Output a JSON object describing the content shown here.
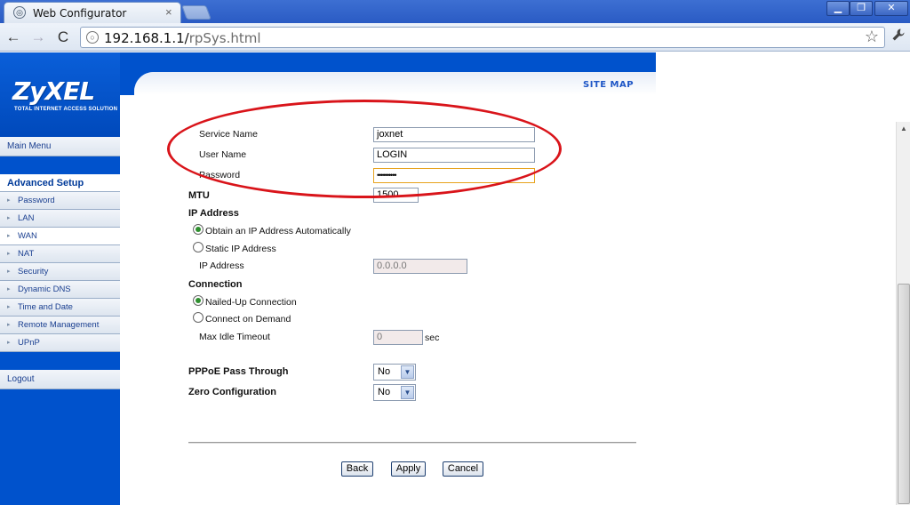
{
  "browser": {
    "tab_title": "Web Configurator",
    "tab_close": "×",
    "url_host": "192.168.1.1/",
    "url_path": "rpSys.html",
    "back_icon": "←",
    "forward_icon": "→",
    "reload_icon": "C",
    "star_icon": "☆",
    "wrench_icon": "wrench-icon",
    "window_buttons": {
      "minimize": "▁",
      "maximize": "❐",
      "close": "✕"
    }
  },
  "logo": {
    "name": "ZyXEL",
    "tagline": "TOTAL INTERNET ACCESS SOLUTION"
  },
  "sidebar": {
    "main_menu": "Main Menu",
    "section": "Advanced Setup",
    "items": [
      {
        "label": "Password"
      },
      {
        "label": "LAN"
      },
      {
        "label": "WAN",
        "active": true
      },
      {
        "label": "NAT"
      },
      {
        "label": "Security"
      },
      {
        "label": "Dynamic DNS"
      },
      {
        "label": "Time and Date"
      },
      {
        "label": "Remote Management"
      },
      {
        "label": "UPnP"
      }
    ],
    "logout": "Logout"
  },
  "header": {
    "site_map": "SITE MAP"
  },
  "form": {
    "service_name": {
      "label": "Service Name",
      "value": "joxnet"
    },
    "user_name": {
      "label": "User Name",
      "value": "LOGIN"
    },
    "password": {
      "label": "Password",
      "value": "••••••••••"
    },
    "mtu": {
      "label": "MTU",
      "value": "1500"
    },
    "ip_address_section": "IP Address",
    "obtain_auto": "Obtain an IP Address Automatically",
    "static_ip": "Static IP Address",
    "ip_address": {
      "label": "IP Address",
      "value": "0.0.0.0"
    },
    "connection_section": "Connection",
    "nailed_up": "Nailed-Up Connection",
    "on_demand": "Connect on Demand",
    "max_idle": {
      "label": "Max Idle Timeout",
      "value": "0",
      "unit": "sec"
    },
    "pppoe_pass": {
      "label": "PPPoE Pass Through",
      "value": "No"
    },
    "zero_config": {
      "label": "Zero Configuration",
      "value": "No"
    }
  },
  "buttons": {
    "back": "Back",
    "apply": "Apply",
    "cancel": "Cancel"
  },
  "colors": {
    "brand_blue": "#0052cc",
    "annotation_red": "#d9141a"
  }
}
